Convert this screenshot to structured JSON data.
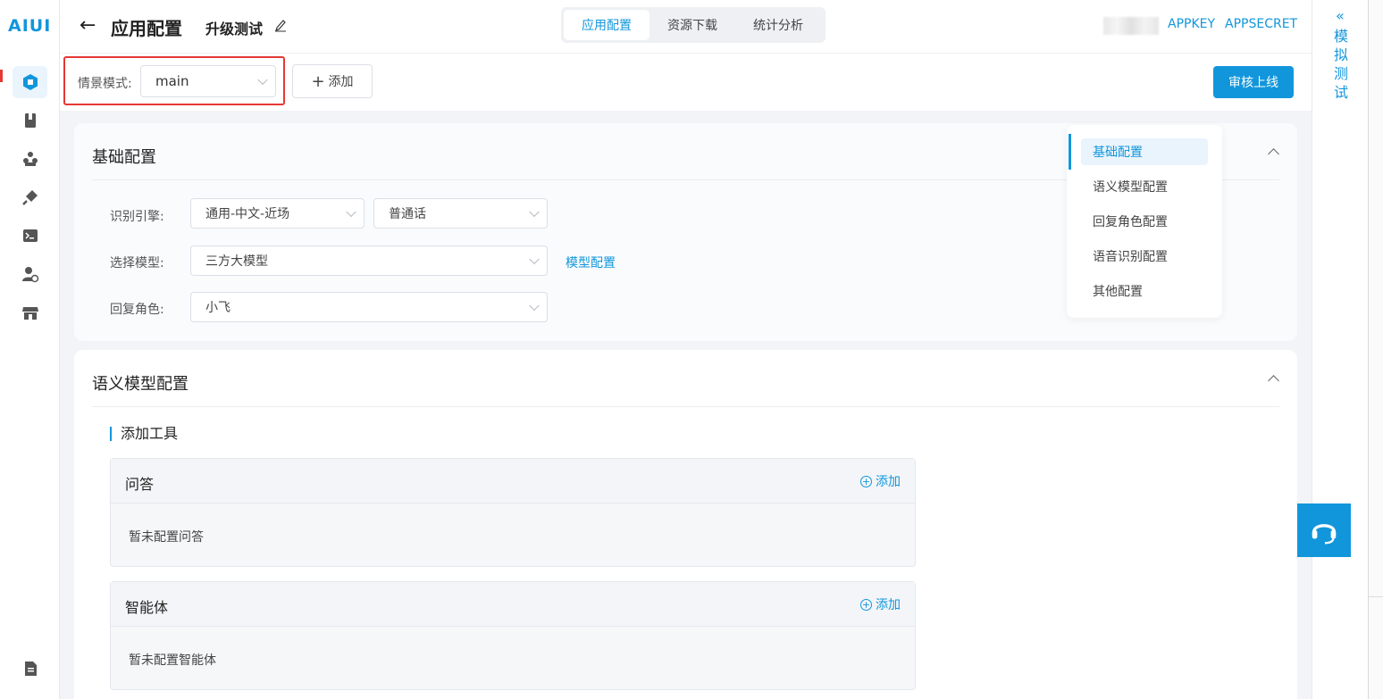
{
  "brand": {
    "logo_text": "AIUI"
  },
  "header": {
    "back_icon": "arrow-left-icon",
    "page_title": "应用配置",
    "app_name": "升级测试",
    "tabs": [
      {
        "label": "应用配置",
        "active": true
      },
      {
        "label": "资源下载",
        "active": false
      },
      {
        "label": "统计分析",
        "active": false
      }
    ],
    "appkey_label": "APPKEY",
    "appsecret_label": "APPSECRET"
  },
  "scene": {
    "label": "情景模式:",
    "selected": "main",
    "add_label": "添加",
    "publish_label": "审核上线"
  },
  "basic_config": {
    "title": "基础配置",
    "engine_label": "识别引擎:",
    "engine_value": "通用-中文-近场",
    "language_value": "普通话",
    "model_label": "选择模型:",
    "model_value": "三方大模型",
    "model_link": "模型配置",
    "role_label": "回复角色:",
    "role_value": "小飞"
  },
  "semantic_config": {
    "title": "语义模型配置",
    "subhead": "添加工具",
    "tools": [
      {
        "title": "问答",
        "add_label": "添加",
        "empty_text": "暂未配置问答"
      },
      {
        "title": "智能体",
        "add_label": "添加",
        "empty_text": "暂未配置智能体"
      }
    ]
  },
  "anchor_nav": {
    "items": [
      {
        "label": "基础配置",
        "active": true
      },
      {
        "label": "语义模型配置",
        "active": false
      },
      {
        "label": "回复角色配置",
        "active": false
      },
      {
        "label": "语音识别配置",
        "active": false
      },
      {
        "label": "其他配置",
        "active": false
      }
    ]
  },
  "simulator": {
    "arrows": "«",
    "label": "模拟测试"
  },
  "colors": {
    "accent": "#1296db",
    "highlight_border": "#e53935"
  }
}
